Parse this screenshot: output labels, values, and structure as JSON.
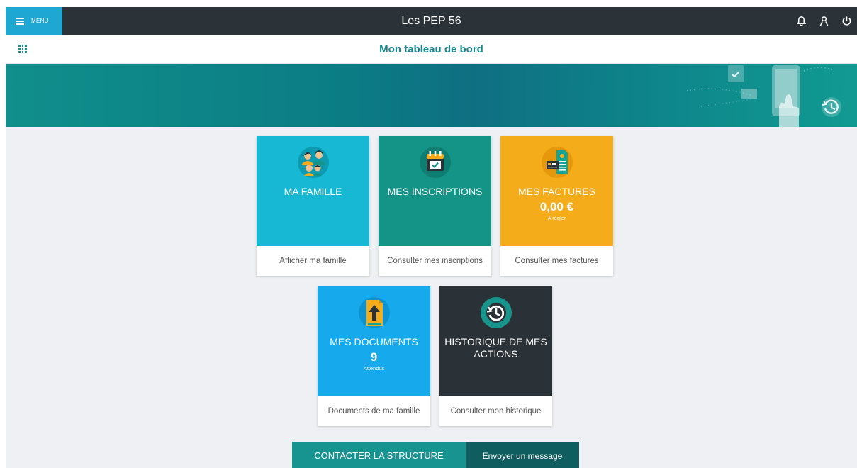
{
  "topbar": {
    "menu_label": "MENU",
    "app_title": "Les PEP 56",
    "icons": [
      "bell-icon",
      "user-icon",
      "power-icon"
    ]
  },
  "subheader": {
    "title": "Mon tableau de bord",
    "icon": "apps-grid-icon"
  },
  "tiles": [
    {
      "title": "MA FAMILLE",
      "link": "Afficher ma famille",
      "color": "#16b8d4",
      "icon": "family-icon"
    },
    {
      "title": "MES INSCRIPTIONS",
      "link": "Consulter mes inscriptions",
      "color": "#149486",
      "icon": "calendar-check-icon"
    },
    {
      "title": "MES FACTURES",
      "amount": "0,00 €",
      "sub": "A régler",
      "link": "Consulter mes factures",
      "color": "#f5ac1a",
      "icon": "invoice-card-icon"
    },
    {
      "title": "MES DOCUMENTS",
      "amount": "9",
      "sub": "Attendus",
      "link": "Documents de ma famille",
      "color": "#16a9ec",
      "icon": "document-upload-icon"
    },
    {
      "title": "HISTORIQUE DE MES ACTIONS",
      "link": "Consulter mon historique",
      "color": "#2b3237",
      "icon": "history-icon"
    }
  ],
  "contact": {
    "label": "CONTACTER LA STRUCTURE",
    "button": "Envoyer un message"
  }
}
